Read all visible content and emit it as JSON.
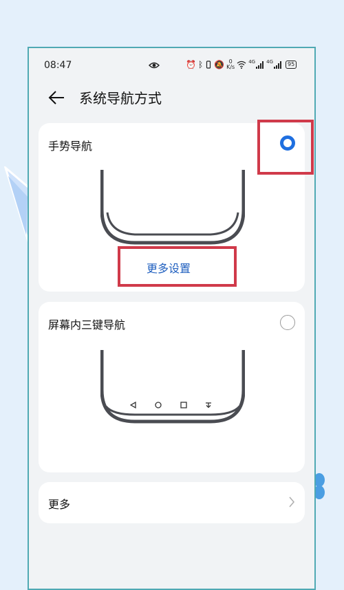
{
  "status_bar": {
    "time": "08:47",
    "net_speed_value": "0",
    "net_speed_unit": "K/s",
    "signal_label_1": "4G",
    "signal_label_2": "4G",
    "battery": "95"
  },
  "header": {
    "title": "系统导航方式"
  },
  "options": {
    "gesture": {
      "label": "手势导航",
      "selected": true,
      "more_settings": "更多设置"
    },
    "three_key": {
      "label": "屏幕内三键导航",
      "selected": false
    }
  },
  "more": {
    "label": "更多"
  },
  "colors": {
    "accent": "#1f6fe0",
    "link": "#1f5fbf",
    "highlight": "#d03a4a",
    "frame": "#4fa9b3"
  }
}
